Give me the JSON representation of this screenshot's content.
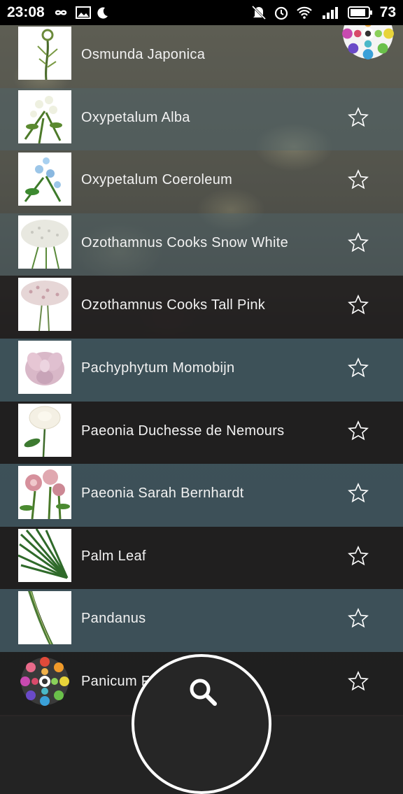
{
  "status_bar": {
    "time": "23:08",
    "battery": "73",
    "icons": [
      "infinity-icon",
      "image-icon",
      "moon-icon",
      "mute-icon",
      "alarm-icon",
      "wifi-icon",
      "signal-icon",
      "battery-icon"
    ]
  },
  "plants": [
    {
      "name": "Osmunda Japonica",
      "thumb": "fern-shoot"
    },
    {
      "name": "Oxypetalum Alba",
      "thumb": "white-flowers"
    },
    {
      "name": "Oxypetalum Coeroleum",
      "thumb": "blue-flowers"
    },
    {
      "name": "Ozothamnus Cooks Snow White",
      "thumb": "white-cluster"
    },
    {
      "name": "Ozothamnus Cooks Tall Pink",
      "thumb": "pink-cluster"
    },
    {
      "name": "Pachyphytum Momobijn",
      "thumb": "succulent"
    },
    {
      "name": "Paeonia Duchesse de Nemours",
      "thumb": "white-peony"
    },
    {
      "name": "Paeonia Sarah Bernhardt",
      "thumb": "pink-peony"
    },
    {
      "name": "Palm Leaf",
      "thumb": "palm-leaf"
    },
    {
      "name": "Pandanus",
      "thumb": "pandanus-leaf"
    },
    {
      "name": "Panicum F",
      "thumb": "app-logo"
    }
  ],
  "colors": {
    "row_dark": "#202020",
    "row_slate": "#3e545c",
    "star_outline": "#ffffff"
  }
}
